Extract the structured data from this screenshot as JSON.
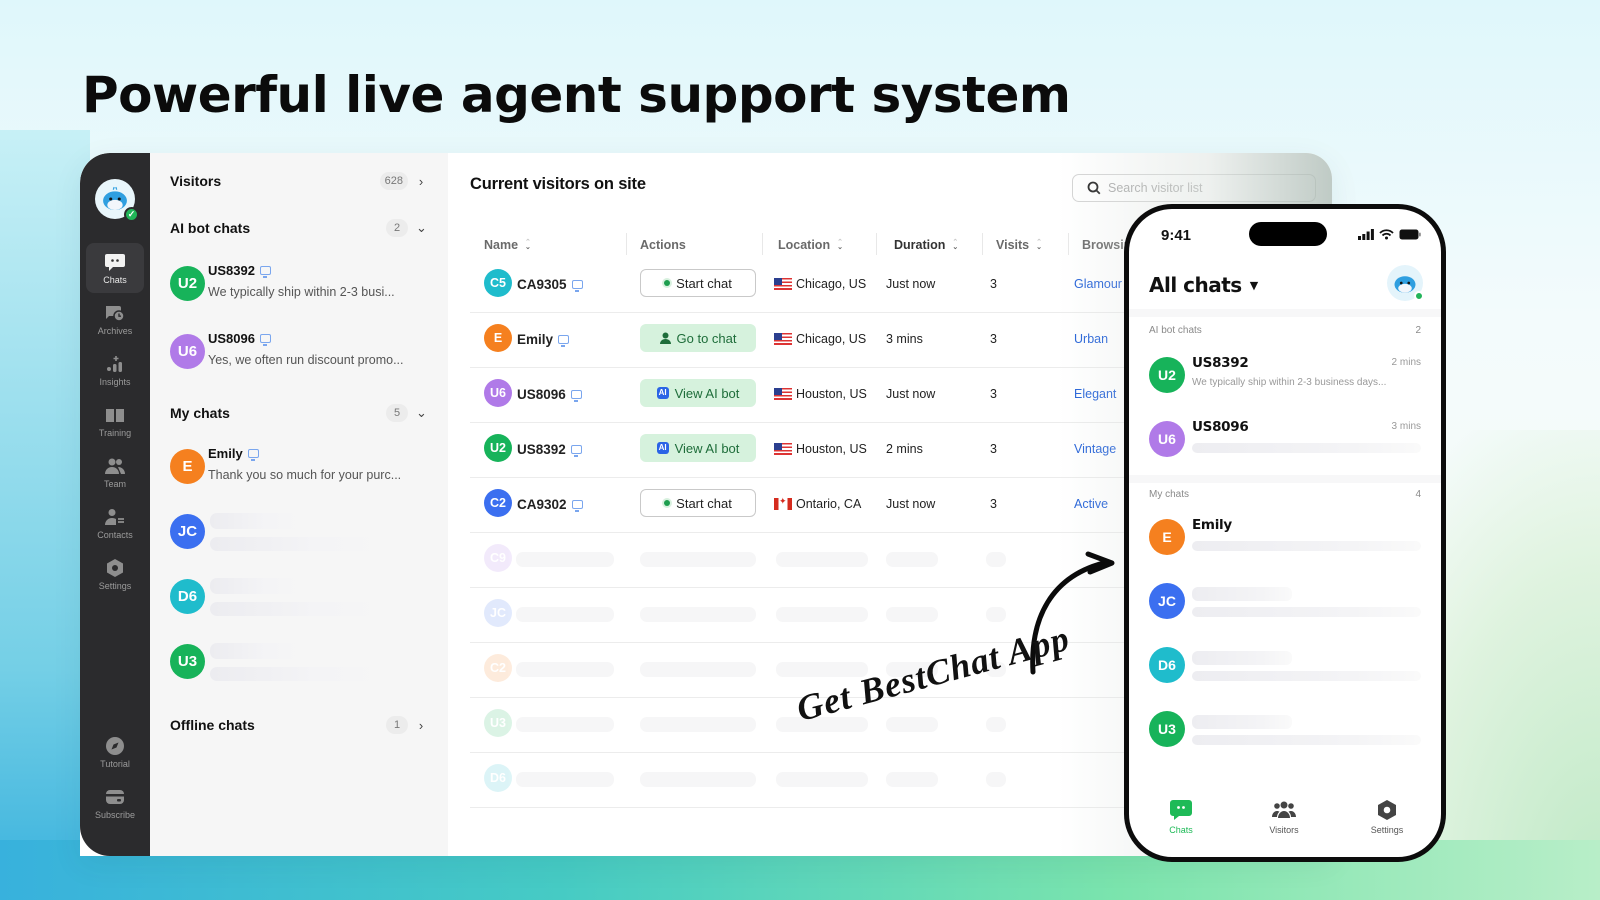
{
  "headline": "Powerful live agent support system",
  "colors": {
    "accent_green": "#1eba57",
    "rail_bg": "#2b2b2d",
    "link_blue": "#2361d8",
    "avatar_green": "#17b35a",
    "avatar_purple": "#b07ae8",
    "avatar_orange": "#f5801f",
    "avatar_blue": "#3b6ff0",
    "avatar_teal": "#1fbccc"
  },
  "rail": {
    "logo_icon": "whale-mascot-icon",
    "items": [
      {
        "label": "Chats",
        "icon": "chat-bubble-icon",
        "active": true
      },
      {
        "label": "Archives",
        "icon": "archive-clock-icon"
      },
      {
        "label": "Insights",
        "icon": "insights-chart-icon"
      },
      {
        "label": "Training",
        "icon": "book-icon"
      },
      {
        "label": "Team",
        "icon": "team-icon"
      },
      {
        "label": "Contacts",
        "icon": "contacts-icon"
      },
      {
        "label": "Settings",
        "icon": "settings-hex-icon"
      },
      {
        "label": "Tutorial",
        "icon": "compass-icon"
      },
      {
        "label": "Subscribe",
        "icon": "card-icon"
      }
    ]
  },
  "chat_list": {
    "visitors": {
      "title": "Visitors",
      "count": "628"
    },
    "ai_bot": {
      "title": "AI bot chats",
      "count": "2",
      "items": [
        {
          "initials": "U2",
          "name": "US8392",
          "message": "We typically ship within 2-3 busi..."
        },
        {
          "initials": "U6",
          "name": "US8096",
          "message": "Yes, we often run discount promo..."
        }
      ]
    },
    "my_chats": {
      "title": "My chats",
      "count": "5",
      "items": [
        {
          "initials": "E",
          "name": "Emily",
          "message": "Thank you so much for your purc..."
        },
        {
          "initials": "JC"
        },
        {
          "initials": "D6"
        },
        {
          "initials": "U3"
        }
      ]
    },
    "offline": {
      "title": "Offline chats",
      "count": "1"
    }
  },
  "main": {
    "title": "Current visitors on site",
    "search_placeholder": "Search visitor list",
    "columns": [
      "Name",
      "Actions",
      "Location",
      "Duration",
      "Visits",
      "Browsing"
    ],
    "rows": [
      {
        "initials": "C5",
        "name": "CA9305",
        "action": "Start chat",
        "action_type": "start",
        "flag": "us",
        "location": "Chicago, US",
        "duration": "Just now",
        "visits": "3",
        "browsing": "Glamour"
      },
      {
        "initials": "E",
        "name": "Emily",
        "action": "Go to chat",
        "action_type": "goto",
        "flag": "us",
        "location": "Chicago, US",
        "duration": "3 mins",
        "visits": "3",
        "browsing": "Urban"
      },
      {
        "initials": "U6",
        "name": "US8096",
        "action": "View AI bot",
        "action_type": "ai",
        "flag": "us",
        "location": "Houston, US",
        "duration": "Just now",
        "visits": "3",
        "browsing": "Elegant"
      },
      {
        "initials": "U2",
        "name": "US8392",
        "action": "View AI bot",
        "action_type": "ai",
        "flag": "us",
        "location": "Houston, US",
        "duration": "2 mins",
        "visits": "3",
        "browsing": "Vintage"
      },
      {
        "initials": "C2",
        "name": "CA9302",
        "action": "Start chat",
        "action_type": "start",
        "flag": "ca",
        "location": "Ontario, CA",
        "duration": "Just now",
        "visits": "3",
        "browsing": "Active"
      }
    ],
    "placeholder_rows": [
      {
        "initials": "C9"
      },
      {
        "initials": "JC"
      },
      {
        "initials": "C2"
      },
      {
        "initials": "U3"
      },
      {
        "initials": "D6"
      }
    ],
    "ai_badge": "AI"
  },
  "annotation": {
    "text": "Get BestChat App"
  },
  "phone": {
    "time": "9:41",
    "title": "All chats",
    "ai_section": {
      "label": "AI bot chats",
      "count": "2"
    },
    "ai_items": [
      {
        "initials": "U2",
        "name": "US8392",
        "time": "2 mins",
        "message": "We typically ship within 2-3 business days..."
      },
      {
        "initials": "U6",
        "name": "US8096",
        "time": "3 mins"
      }
    ],
    "my_section": {
      "label": "My chats",
      "count": "4"
    },
    "my_items": [
      {
        "initials": "E",
        "name": "Emily"
      },
      {
        "initials": "JC"
      },
      {
        "initials": "D6"
      },
      {
        "initials": "U3"
      }
    ],
    "tabs": [
      {
        "label": "Chats",
        "active": true
      },
      {
        "label": "Visitors"
      },
      {
        "label": "Settings"
      }
    ]
  }
}
